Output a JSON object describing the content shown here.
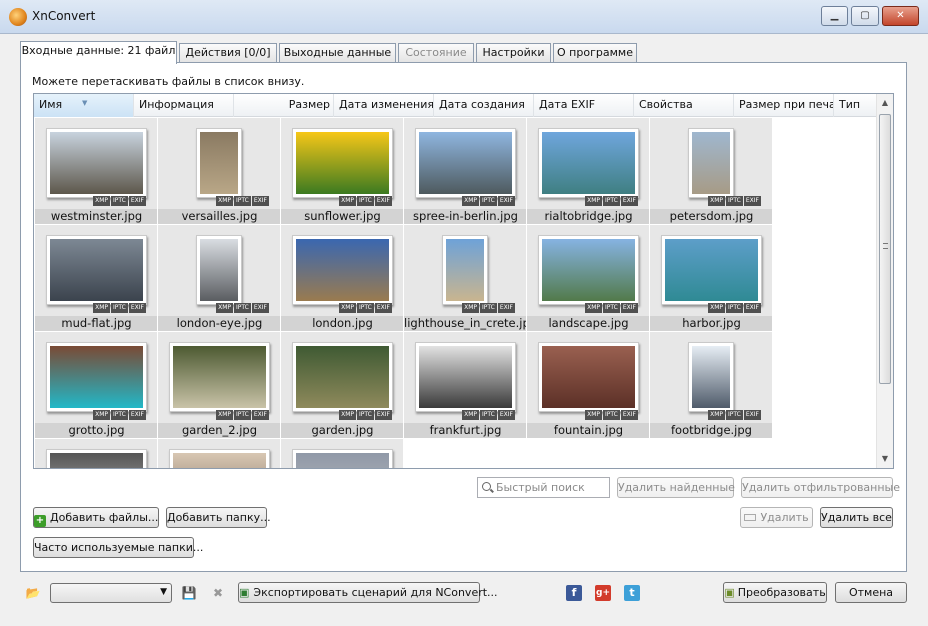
{
  "window": {
    "title": "XnConvert",
    "minimize": "▁",
    "maximize": "▢",
    "close": "✕"
  },
  "tabs": [
    {
      "label": "Входные данные: 21 файл",
      "active": true
    },
    {
      "label": "Действия [0/0]"
    },
    {
      "label": "Выходные данные"
    },
    {
      "label": "Состояние",
      "disabled": true
    },
    {
      "label": "Настройки"
    },
    {
      "label": "О программе"
    }
  ],
  "hint": "Можете перетаскивать файлы в список внизу.",
  "columns": [
    "Имя",
    "Информация",
    "Размер",
    "Дата изменения",
    "Дата создания",
    "Дата EXIF",
    "Свойства",
    "Размер при печа",
    "Тип"
  ],
  "badges": [
    "XMP",
    "IPTC",
    "EXIF"
  ],
  "files": [
    {
      "name": "westminster.jpg",
      "orientation": "landscape",
      "colors": [
        "#c8d3de",
        "#5d574b"
      ]
    },
    {
      "name": "versailles.jpg",
      "orientation": "portrait",
      "colors": [
        "#8a7a62",
        "#b9a787"
      ]
    },
    {
      "name": "sunflower.jpg",
      "orientation": "landscape",
      "colors": [
        "#f6c718",
        "#3b7a21"
      ]
    },
    {
      "name": "spree-in-berlin.jpg",
      "orientation": "landscape",
      "colors": [
        "#8fb6e0",
        "#4e5a5e"
      ]
    },
    {
      "name": "rialtobridge.jpg",
      "orientation": "landscape",
      "colors": [
        "#6fa6dd",
        "#3f7f82"
      ]
    },
    {
      "name": "petersdom.jpg",
      "orientation": "portrait",
      "colors": [
        "#9fb7cf",
        "#a79b86"
      ]
    },
    {
      "name": "mud-flat.jpg",
      "orientation": "landscape",
      "colors": [
        "#7d8894",
        "#3b434d"
      ]
    },
    {
      "name": "london-eye.jpg",
      "orientation": "portrait",
      "colors": [
        "#d9dde2",
        "#5a5d61"
      ]
    },
    {
      "name": "london.jpg",
      "orientation": "landscape",
      "colors": [
        "#3a67b0",
        "#9a7b4f"
      ]
    },
    {
      "name": "lighthouse_in_crete.jpg",
      "orientation": "portrait",
      "colors": [
        "#6ea2d8",
        "#c9b58f"
      ]
    },
    {
      "name": "landscape.jpg",
      "orientation": "landscape",
      "colors": [
        "#86b3e2",
        "#527a4a"
      ]
    },
    {
      "name": "harbor.jpg",
      "orientation": "landscape",
      "colors": [
        "#5d9ec9",
        "#2f8a94"
      ]
    },
    {
      "name": "grotto.jpg",
      "orientation": "landscape",
      "colors": [
        "#7a4a35",
        "#22b8c8"
      ]
    },
    {
      "name": "garden_2.jpg",
      "orientation": "landscape",
      "colors": [
        "#4d5a32",
        "#c9c3a8"
      ]
    },
    {
      "name": "garden.jpg",
      "orientation": "landscape",
      "colors": [
        "#3f5a33",
        "#8f8a5c"
      ]
    },
    {
      "name": "frankfurt.jpg",
      "orientation": "landscape",
      "colors": [
        "#e2e2e2",
        "#3a3a3a"
      ]
    },
    {
      "name": "fountain.jpg",
      "orientation": "landscape",
      "colors": [
        "#9a6050",
        "#5c3027"
      ]
    },
    {
      "name": "footbridge.jpg",
      "orientation": "portrait",
      "colors": [
        "#e6edf4",
        "#4f5b6a"
      ]
    },
    {
      "name": "",
      "orientation": "landscape",
      "colors": [
        "#555",
        "#bdbdbd"
      ]
    },
    {
      "name": "",
      "orientation": "landscape",
      "colors": [
        "#d8c7b3",
        "#7e6b5a"
      ]
    },
    {
      "name": "",
      "orientation": "landscape",
      "colors": [
        "#9099a8",
        "#bcbcbc"
      ]
    }
  ],
  "search": {
    "placeholder": "Быстрый поиск"
  },
  "buttons": {
    "remove_found": "Удалить найденные",
    "remove_filtered": "Удалить отфильтрованные",
    "add_files": "Добавить файлы...",
    "add_folder": "Добавить папку...",
    "remove": "Удалить",
    "remove_all": "Удалить все",
    "frequent_folders": "Часто используемые папки...",
    "export_script": "Экспортировать сценарий для NConvert...",
    "convert": "Преобразовать",
    "cancel": "Отмена"
  },
  "social": {
    "facebook": "f",
    "googleplus": "g+",
    "twitter": "t"
  }
}
